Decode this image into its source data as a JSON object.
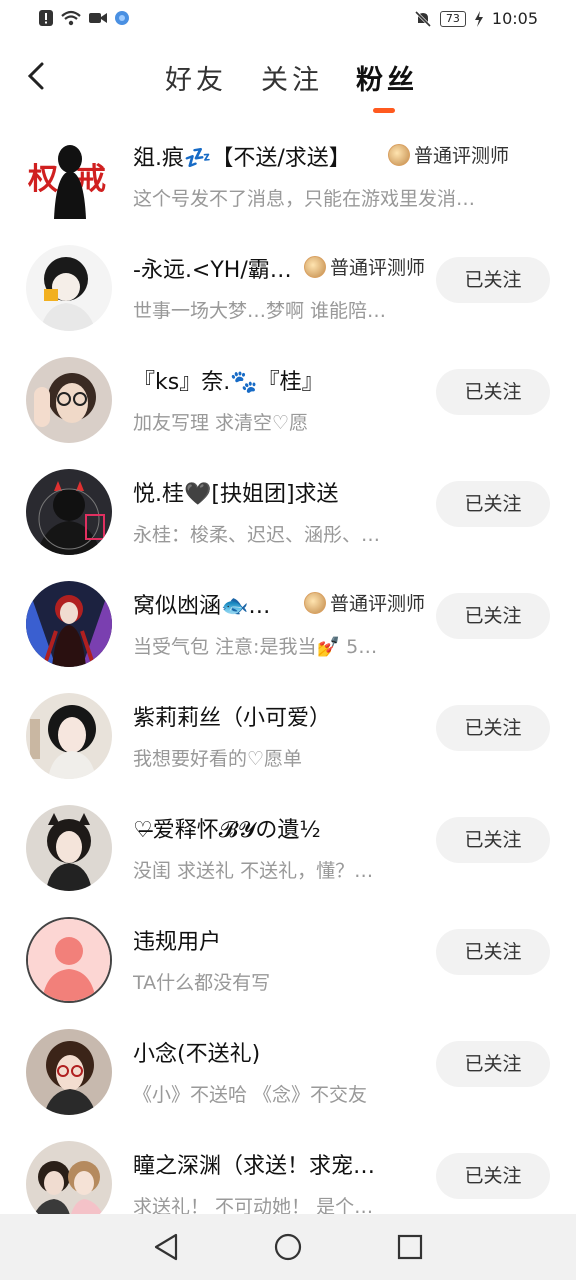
{
  "status_bar": {
    "battery": "73",
    "time": "10:05",
    "icons": [
      "alert-icon",
      "wifi-icon",
      "video-icon",
      "app-icon",
      "bell-muted-icon",
      "charging-icon"
    ]
  },
  "header": {
    "back_icon": "back-arrow-icon",
    "tabs": [
      {
        "label": "好友",
        "active": false
      },
      {
        "label": "关注",
        "active": false
      },
      {
        "label": "粉丝",
        "active": true
      }
    ],
    "accent_color": "#ff5a1f"
  },
  "users": [
    {
      "name": "爼.痕💤【不送/求送】",
      "badge": "普通评测师",
      "bio": "这个号发不了消息，只能在游戏里发消…",
      "button": ""
    },
    {
      "name": "-永远.<YH/霸…",
      "badge": "普通评测师",
      "bio": "世事一场大梦…梦啊 谁能陪…",
      "button": "已关注"
    },
    {
      "name": "『ks』奈.🐾『桂』",
      "badge": "",
      "bio": "加友写理  求清空♡愿",
      "button": "已关注"
    },
    {
      "name": "悦.桂🖤[抉姐团]求送",
      "badge": "",
      "bio": "永桂：梭柔、迟迟、涵彤、…",
      "button": "已关注"
    },
    {
      "name": "窝似凼涵🐟…",
      "badge": "普通评测师",
      "bio": "当受气包 注意:是我当💅 5…",
      "button": "已关注"
    },
    {
      "name": "紫莉莉丝（小可爱）",
      "badge": "",
      "bio": "我想要好看的♡愿单",
      "button": "已关注"
    },
    {
      "name": "♡̶爱释怀𝓑𝓨の遺½",
      "badge": "",
      "bio": "没闺 求送礼 不送礼，懂？…",
      "button": "已关注"
    },
    {
      "name": "违规用户",
      "badge": "",
      "bio": "TA什么都没有写",
      "button": "已关注"
    },
    {
      "name": "小念(不送礼)",
      "badge": "",
      "bio": "《小》不送哈 《念》不交友",
      "button": "已关注"
    },
    {
      "name": "瞳之深渊（求送！求宠…",
      "badge": "",
      "bio": "求送礼！ 不可动她！ 是个…",
      "button": "已关注"
    }
  ],
  "nav_bar": {
    "back": "triangle-back-icon",
    "home": "circle-home-icon",
    "recents": "square-recents-icon"
  }
}
